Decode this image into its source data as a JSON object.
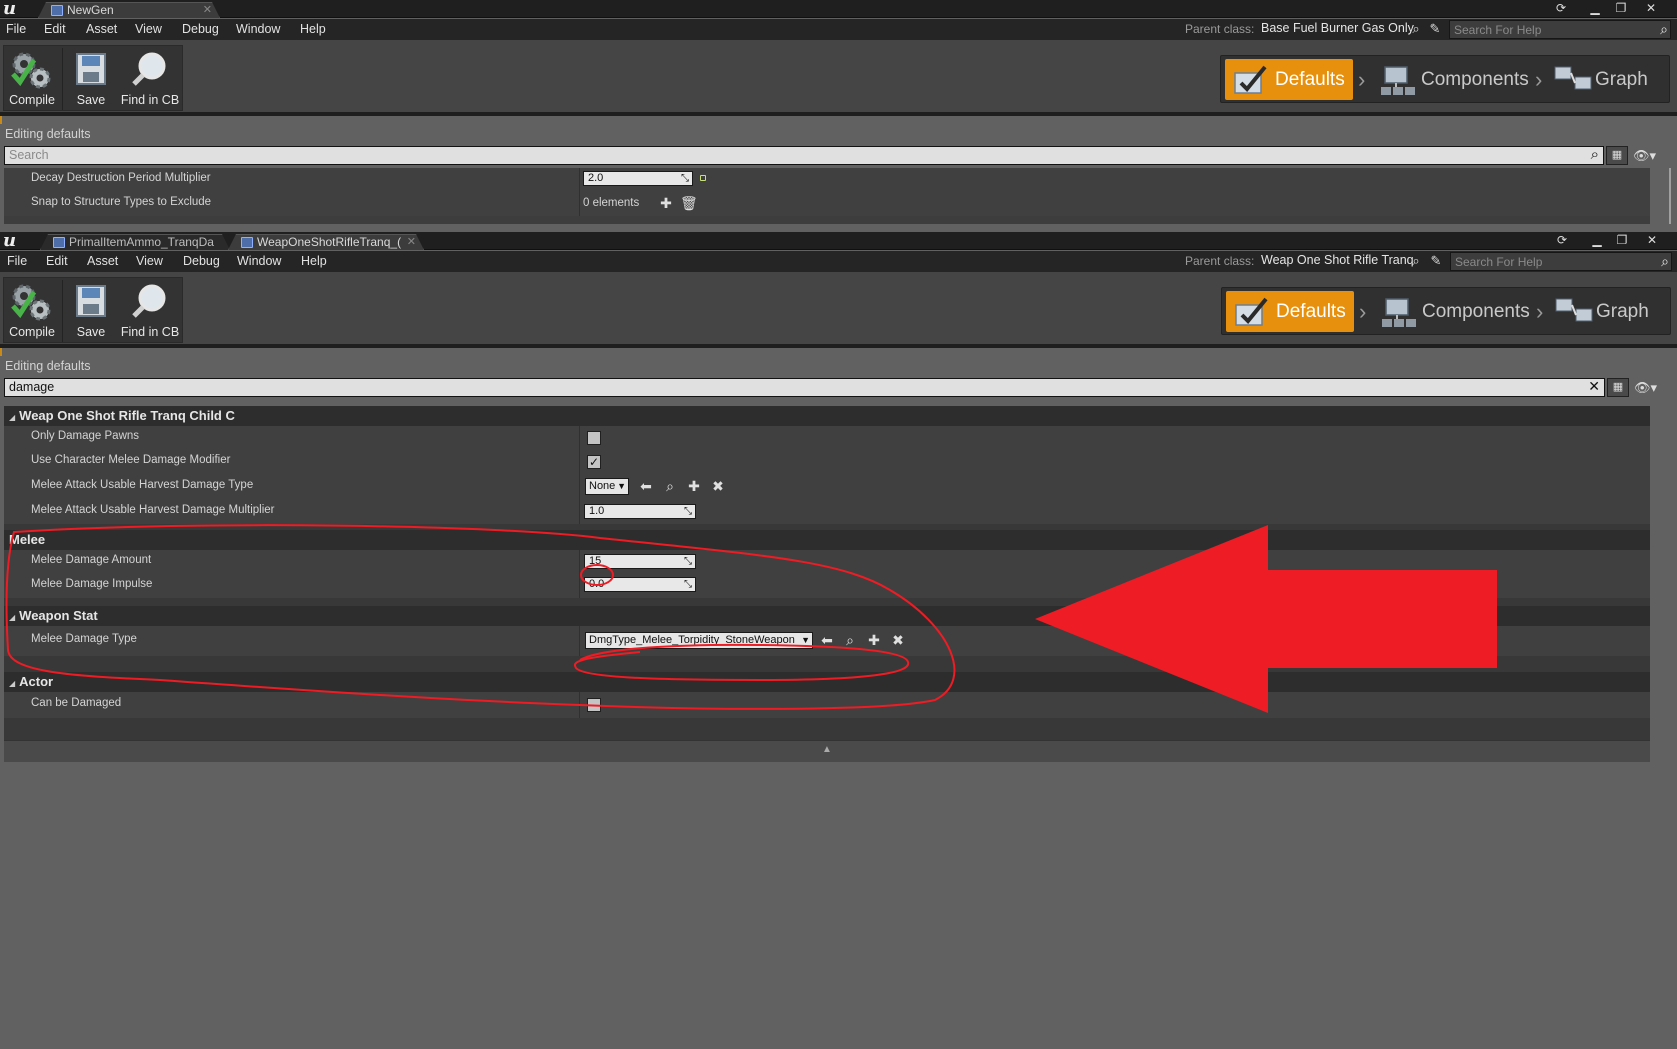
{
  "window1": {
    "tabs": [
      {
        "label": "NewGen"
      }
    ],
    "menu": [
      "File",
      "Edit",
      "Asset",
      "View",
      "Debug",
      "Window",
      "Help"
    ],
    "parent_class_label": "Parent class:",
    "parent_class_value": "Base Fuel Burner Gas Only",
    "help_search_placeholder": "Search For Help",
    "toolbar": {
      "compile": "Compile",
      "save": "Save",
      "find": "Find in CB"
    },
    "modes": {
      "defaults": "Defaults",
      "components": "Components",
      "graph": "Graph"
    },
    "editing_label": "Editing defaults",
    "search_placeholder": "Search",
    "rows": [
      {
        "label": "Decay Destruction Period Multiplier",
        "value": "2.0"
      },
      {
        "label": "Snap to Structure Types to Exclude",
        "value": "0 elements"
      }
    ]
  },
  "window2": {
    "tabs": [
      {
        "label": "PrimalItemAmmo_TranqDa"
      },
      {
        "label": "WeapOneShotRifleTranq_("
      }
    ],
    "menu": [
      "File",
      "Edit",
      "Asset",
      "View",
      "Debug",
      "Window",
      "Help"
    ],
    "parent_class_label": "Parent class:",
    "parent_class_value": "Weap One Shot Rifle Tranq",
    "help_search_placeholder": "Search For Help",
    "toolbar": {
      "compile": "Compile",
      "save": "Save",
      "find": "Find in CB"
    },
    "modes": {
      "defaults": "Defaults",
      "components": "Components",
      "graph": "Graph"
    },
    "editing_label": "Editing defaults",
    "search_value": "damage",
    "categories": {
      "weap": {
        "title": "Weap One Shot Rifle Tranq Child C",
        "rows": [
          {
            "label": "Only Damage Pawns",
            "checked": false
          },
          {
            "label": "Use Character Melee Damage Modifier",
            "checked": true
          },
          {
            "label": "Melee Attack Usable Harvest Damage Type",
            "value": "None"
          },
          {
            "label": "Melee Attack Usable Harvest Damage Multiplier",
            "value": "1.0"
          }
        ]
      },
      "melee": {
        "title": "Melee",
        "rows": [
          {
            "label": "Melee Damage Amount",
            "value": "15"
          },
          {
            "label": "Melee Damage Impulse",
            "value": "0.0"
          }
        ]
      },
      "weapon_stat": {
        "title": "Weapon Stat",
        "rows": [
          {
            "label": "Melee Damage Type",
            "value": "DmgType_Melee_Torpidity_StoneWeapon"
          }
        ]
      },
      "actor": {
        "title": "Actor",
        "rows": [
          {
            "label": "Can be Damaged",
            "checked": false
          }
        ]
      }
    }
  },
  "colors": {
    "accent_orange": "#e6900d",
    "annotation_red": "#ee1c24",
    "background": "#616161"
  }
}
